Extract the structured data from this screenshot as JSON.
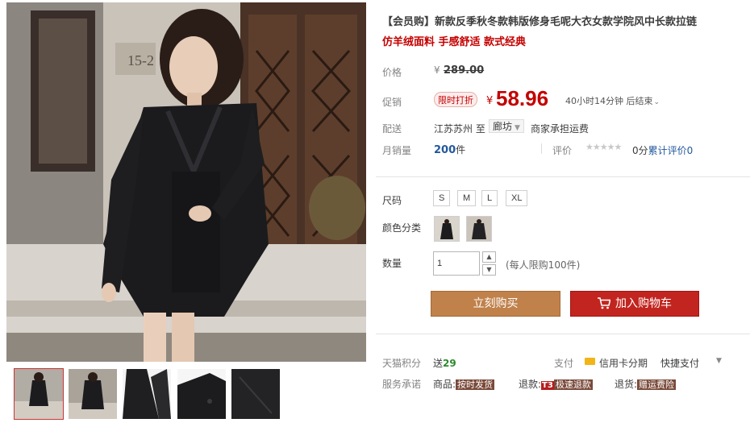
{
  "product": {
    "title": "【会员购】新款反季秋冬款韩版修身毛呢大衣女款学院风中长款拉链",
    "subtitle": "仿羊绒面料 手感舒适 款式经典"
  },
  "price": {
    "label": "价格",
    "currency": "¥",
    "original": "289.00"
  },
  "promotion": {
    "label": "促销",
    "tag": "限时打折",
    "currency": "¥",
    "price": "58.96",
    "countdown": "40小时14分钟 后结束"
  },
  "shipping": {
    "label": "配送",
    "from": "江苏苏州",
    "to_word": "至",
    "destination": "廊坊",
    "note": "商家承担运费"
  },
  "sales": {
    "label": "月销量",
    "count": "200",
    "unit": "件",
    "review_label": "评价",
    "stars": "★★★★★",
    "score": "0分",
    "review_text": "累计评价",
    "review_count": "0"
  },
  "options": {
    "size_label": "尺码",
    "sizes": [
      "S",
      "M",
      "L",
      "XL"
    ],
    "color_label": "颜色分类",
    "qty_label": "数量",
    "qty_value": "1",
    "qty_limit": "(每人限购100件)"
  },
  "actions": {
    "buy_now": "立刻购买",
    "add_cart": "加入购物车"
  },
  "extra": {
    "points_label": "天猫积分",
    "points_prefix": "送",
    "points_value": "29",
    "pay_label": "支付",
    "pay_credit": "信用卡分期",
    "pay_quick": "快捷支付",
    "service_label": "服务承诺",
    "svc_goods": "商品:",
    "svc_goods_tag": "按时发货",
    "svc_refund": "退款:",
    "svc_refund_t3": "T3",
    "svc_refund_tag": "极速退款",
    "svc_return": "退货:",
    "svc_return_tag": "赠运费险"
  },
  "colors": {
    "accent_red": "#c40000",
    "buy_button": "#c0814b",
    "cart_button": "#c2251f",
    "link_blue": "#23589c"
  },
  "icons": [
    "cart-icon",
    "credit-card-icon",
    "chevron-down-icon",
    "star-icon",
    "arrow-up-icon",
    "arrow-down-icon"
  ]
}
